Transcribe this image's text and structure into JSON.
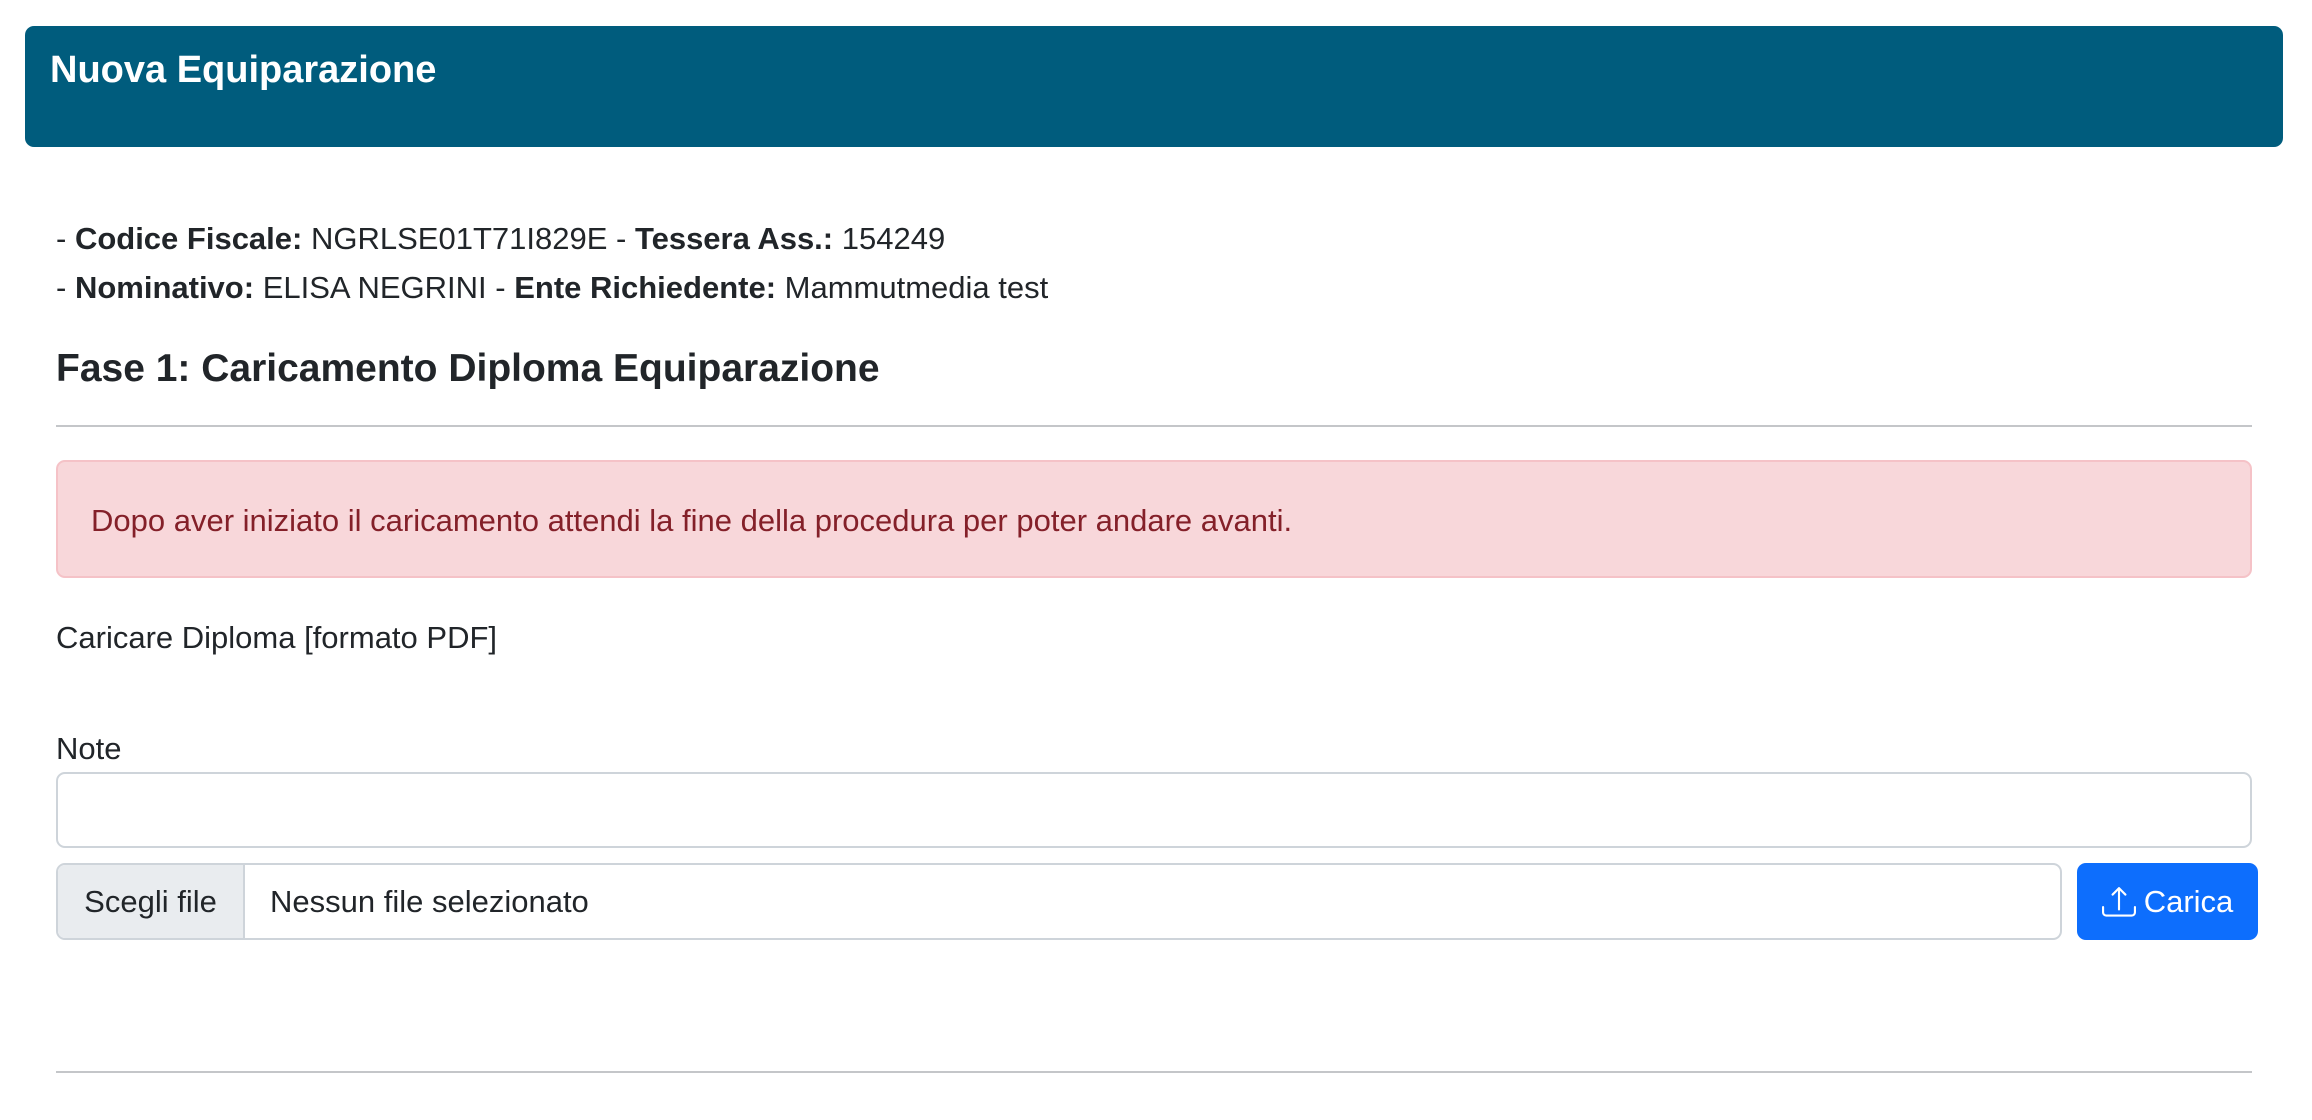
{
  "header": {
    "title": "Nuova Equiparazione"
  },
  "info": {
    "prefix": "- ",
    "codice_fiscale_label": "Codice Fiscale:",
    "codice_fiscale_value": "NGRLSE01T71I829E",
    "separator": " - ",
    "tessera_label": "Tessera Ass.:",
    "tessera_value": "154249",
    "nominativo_label": "Nominativo:",
    "nominativo_value": "ELISA NEGRINI",
    "ente_label": "Ente Richiedente:",
    "ente_value": "Mammutmedia test"
  },
  "phase": {
    "title": "Fase 1: Caricamento Diploma Equiparazione"
  },
  "alert": {
    "text": "Dopo aver iniziato il caricamento attendi la fine della procedura per poter andare avanti."
  },
  "upload": {
    "label": "Caricare Diploma [formato PDF]",
    "file_button": "Scegli file",
    "file_status": "Nessun file selezionato",
    "submit_label": "Carica"
  },
  "note": {
    "label": "Note",
    "value": "",
    "placeholder": ""
  },
  "colors": {
    "header_bg": "#005c7d",
    "alert_bg": "#f8d7da",
    "alert_text": "#842029",
    "primary": "#0d6efd"
  }
}
